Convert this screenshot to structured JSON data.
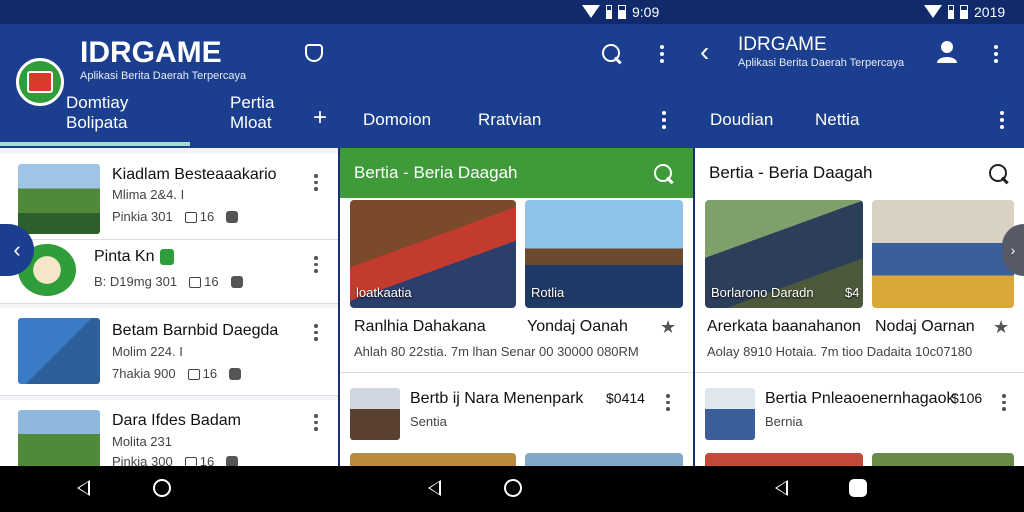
{
  "status": [
    {
      "time": "9:09"
    },
    {
      "time": "2019"
    }
  ],
  "header": {
    "brand": "IDRGAME",
    "tagline": "Aplikasi Berita Daerah Terpercaya",
    "brand2": "IDRGAME",
    "tagline2": "Aplikasi Berita Daerah Terpercaya"
  },
  "tabs": [
    {
      "label": "Domtiay\nBolipata"
    },
    {
      "label": "Pertia\nMloat"
    },
    {
      "label": "Domoion"
    },
    {
      "label": "Rratvian"
    },
    {
      "label": "Doudian"
    },
    {
      "label": "Nettia"
    }
  ],
  "list": [
    {
      "title": "Kiadlam Besteaaakario",
      "sub": "Mlima 2&4. I",
      "meta": "Pinkia 301",
      "count": "16"
    },
    {
      "title": "Pinta Kn",
      "sub": "",
      "meta": "B: D19mg 301",
      "count": "16"
    },
    {
      "title": "Betam Barnbid Daegda",
      "sub": "Molim 224. I",
      "meta": "7hakia 900",
      "count": "16"
    },
    {
      "title": "Dara Ifdes Badam",
      "sub": "Molita 231",
      "meta": "Pinkia 300",
      "count": "16"
    }
  ],
  "panel2": {
    "title": "Bertia - Beria Daagah",
    "cards": [
      {
        "caption": "loatkaatia",
        "title": "Ranlhia Dahakana"
      },
      {
        "caption": "Rotlia",
        "title": "Yondaj Oanah"
      }
    ],
    "meta": "Ahlah 80 22stia.  7m  lhan Senar 00 30000 080RM",
    "row_title": "Bertb ij Nara Menenpark",
    "row_price": "$0414",
    "row_sub": "Sentia"
  },
  "panel3": {
    "title": "Bertia - Beria Daagah",
    "cards": [
      {
        "caption": "Borlarono Daradn",
        "badge": "$4",
        "title": "Arerkata baanahanon"
      },
      {
        "caption": "",
        "badge": "",
        "title": "Nodaj Oarnan"
      }
    ],
    "meta": "Aolay 8910 Hotaia.  7m  tioo Dadaita 10c07180",
    "row_title": "Bertia Pnleaoenernhagaok",
    "row_price": "$106",
    "row_sub": "Bernia"
  },
  "icons": [
    "wifi-icon",
    "signal-icon",
    "battery-icon",
    "search-icon",
    "more-icon",
    "back-icon",
    "profile-icon",
    "plus-icon",
    "star-icon",
    "comment-icon",
    "share-icon",
    "chevron-left-icon",
    "home-icon"
  ],
  "colors": {
    "appbar": "#1b3f8e",
    "status": "#102a6b",
    "green_header": "#3f9a3a",
    "accent": "#9fe0c7"
  }
}
